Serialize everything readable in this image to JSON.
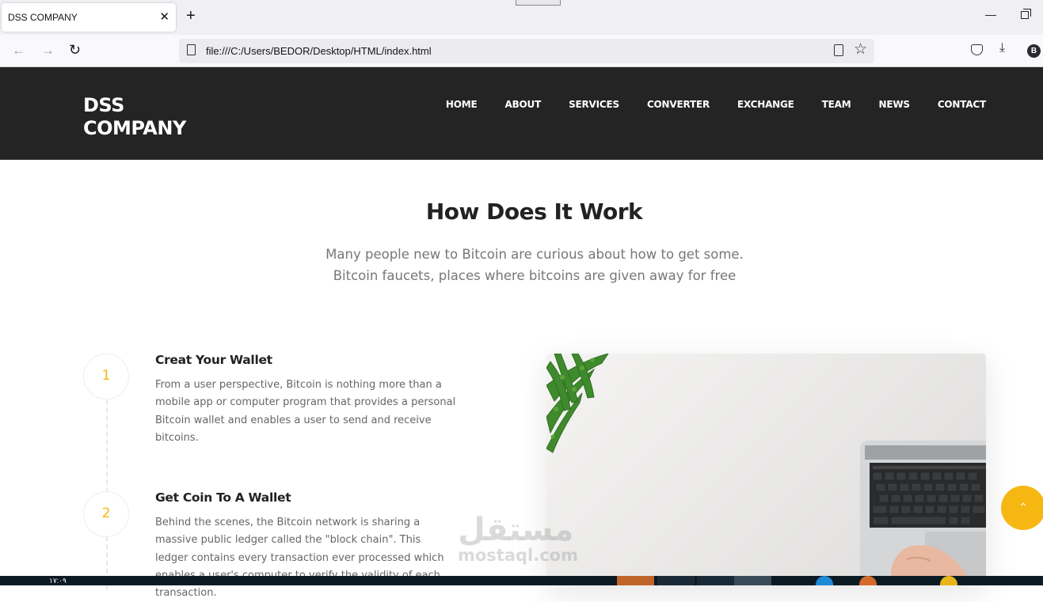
{
  "browser": {
    "tab_title": "DSS COMPANY",
    "tab_close": "✕",
    "new_tab": "+",
    "url": "file:///C:/Users/BEDOR/Desktop/HTML/index.html",
    "profile_initial": "B",
    "icons": [
      "back-icon",
      "forward-icon",
      "reload-icon",
      "page-icon",
      "reader-view-icon",
      "bookmark-star-icon",
      "pocket-icon",
      "download-icon",
      "profile-icon",
      "minimize-icon",
      "restore-icon"
    ]
  },
  "site": {
    "logo_line1": "DSS",
    "logo_line2": "COMPANY",
    "menu": [
      "HOME",
      "ABOUT",
      "SERVICES",
      "CONVERTER",
      "EXCHANGE",
      "TEAM",
      "NEWS",
      "CONTACT"
    ]
  },
  "section": {
    "title": "How Does It Work",
    "subtitle": "Many people new to Bitcoin are curious about how to get some. Bitcoin faucets, places where bitcoins are given away for free"
  },
  "steps": [
    {
      "number": "1",
      "title": "Creat Your Wallet",
      "text": "From a user perspective, Bitcoin is nothing more than a mobile app or computer program that provides a personal Bitcoin wallet and enables a user to send and receive bitcoins."
    },
    {
      "number": "2",
      "title": "Get Coin To A Wallet",
      "text": "Behind the scenes, the Bitcoin network is sharing a massive public ledger called the \"block chain\". This ledger contains every transaction ever processed which enables a user's computer to verify the validity of each transaction."
    }
  ],
  "scroll_top": "⌃",
  "watermark": {
    "arabic": "مستقل",
    "latin": "mostaql.com"
  },
  "taskbar": {
    "time": "١٧:٠٩"
  },
  "colors": {
    "header_bg": "#242424",
    "accent": "#f5b60f",
    "text_dark": "#222222",
    "text_muted": "#777777"
  }
}
